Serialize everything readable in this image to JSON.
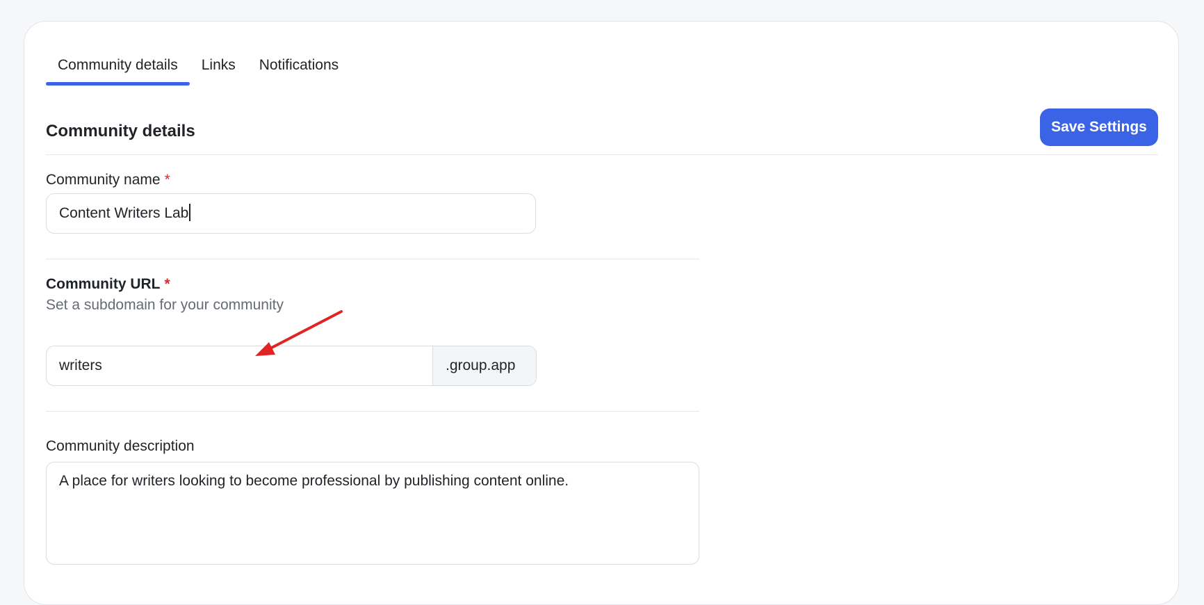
{
  "tabs": [
    {
      "label": "Community details",
      "active": true
    },
    {
      "label": "Links",
      "active": false
    },
    {
      "label": "Notifications",
      "active": false
    }
  ],
  "section": {
    "title": "Community details",
    "save_label": "Save Settings"
  },
  "fields": {
    "name": {
      "label": "Community name",
      "required_mark": "*",
      "value": "Content Writers Lab"
    },
    "url": {
      "label": "Community URL",
      "required_mark": "*",
      "hint": "Set a subdomain for your community",
      "value": "writers",
      "suffix": ".group.app"
    },
    "description": {
      "label": "Community description",
      "value": "A place for writers looking to become professional by publishing content online."
    }
  },
  "colors": {
    "accent": "#3b63e6",
    "required": "#e5262a",
    "annotation_arrow": "#e02424"
  },
  "annotation": {
    "icon": "red-arrow-icon"
  }
}
